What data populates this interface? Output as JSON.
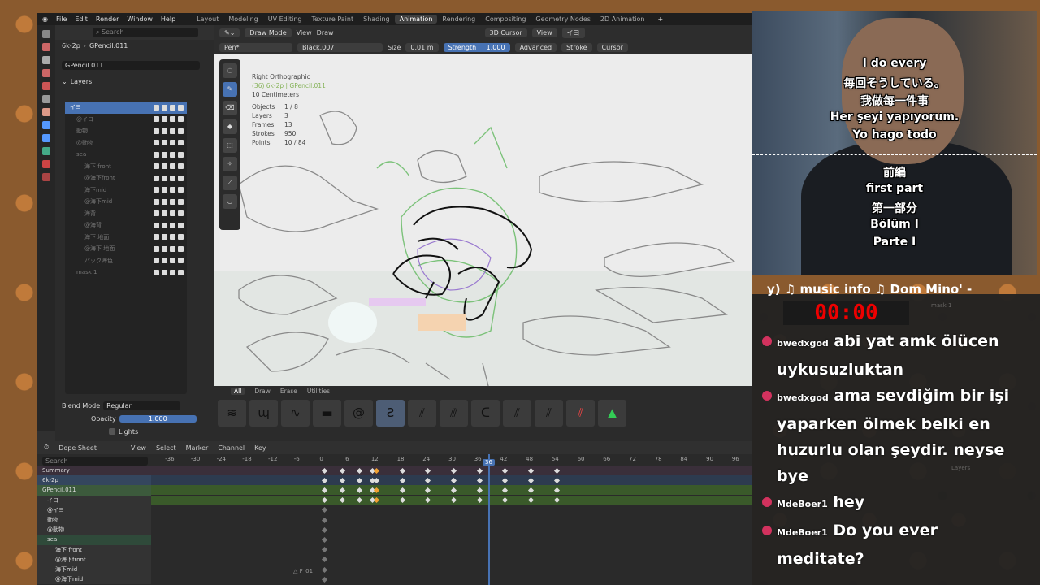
{
  "menus": [
    "File",
    "Edit",
    "Render",
    "Window",
    "Help"
  ],
  "workspaces": [
    {
      "label": "Layout",
      "active": false
    },
    {
      "label": "Modeling",
      "active": false
    },
    {
      "label": "UV Editing",
      "active": false
    },
    {
      "label": "Texture Paint",
      "active": false
    },
    {
      "label": "Shading",
      "active": false
    },
    {
      "label": "Animation",
      "active": true
    },
    {
      "label": "Rendering",
      "active": false
    },
    {
      "label": "Compositing",
      "active": false
    },
    {
      "label": "Geometry Nodes",
      "active": false
    },
    {
      "label": "2D Animation",
      "active": false
    }
  ],
  "props": {
    "object": "6k-2p",
    "data": "GPencil.011",
    "datablock": "GPencil.011",
    "search_placeholder": "Search",
    "layers_title": "Layers",
    "blend_mode_label": "Blend Mode",
    "blend_mode": "Regular",
    "opacity_label": "Opacity",
    "opacity": "1.000",
    "lights_label": "Lights"
  },
  "layers": [
    {
      "name": "イヨ",
      "sel": true
    },
    {
      "name": "@イヨ"
    },
    {
      "name": "動物"
    },
    {
      "name": "@動物"
    },
    {
      "name": "sea"
    },
    {
      "name": "海下 front"
    },
    {
      "name": "@海下front"
    },
    {
      "name": "海下mid"
    },
    {
      "name": "@海下mid"
    },
    {
      "name": "海背"
    },
    {
      "name": "@海背"
    },
    {
      "name": "海下 地面"
    },
    {
      "name": "@海下 地面"
    },
    {
      "name": "バック海色"
    },
    {
      "name": "mask 1"
    }
  ],
  "viewport": {
    "mode": "Draw Mode",
    "view": "View",
    "draw": "Draw",
    "cursor": "3D Cursor",
    "view2": "View",
    "layer": "イヨ",
    "brush": "Pen*",
    "material": "Black.007",
    "size_label": "Size",
    "size": "0.01 m",
    "strength_label": "Strength",
    "strength": "1.000",
    "advanced": "Advanced",
    "stroke": "Stroke",
    "cursor2": "Cursor"
  },
  "overlay": {
    "view_name": "Right Orthographic",
    "object_line": "(36) 6k-2p | GPencil.011",
    "scale": "10 Centimeters",
    "stats": [
      [
        "Objects",
        "1 / 8"
      ],
      [
        "Layers",
        "3"
      ],
      [
        "Frames",
        "13"
      ],
      [
        "Strokes",
        "950"
      ],
      [
        "Points",
        "10 / 84"
      ]
    ]
  },
  "brush_tabs": [
    {
      "label": "All",
      "on": true
    },
    {
      "label": "Draw"
    },
    {
      "label": "Erase"
    },
    {
      "label": "Utilities"
    }
  ],
  "dope": {
    "editor": "Dope Sheet",
    "menus": [
      "View",
      "Select",
      "Marker",
      "Channel",
      "Key"
    ],
    "search_placeholder": "Search",
    "frame": "36",
    "marker": "F_01",
    "ruler": [
      "-36",
      "-30",
      "-24",
      "-18",
      "-12",
      "-6",
      "0",
      "6",
      "12",
      "18",
      "24",
      "30",
      "36",
      "42",
      "48",
      "54",
      "60",
      "66",
      "72",
      "78",
      "84",
      "90",
      "96"
    ],
    "channels": [
      "Summary",
      "6k-2p",
      "GPencil.011",
      "イヨ",
      "@イヨ",
      "動物",
      "@動物",
      "sea",
      "海下 front",
      "@海下front",
      "海下mid",
      "@海下mid"
    ]
  },
  "stream": {
    "sub_top": [
      "I do every",
      "毎回そうしている。",
      "我做每一件事",
      "Her şeyi yapıyorum.",
      "Yo hago todo"
    ],
    "sub_bottom": [
      "前編",
      "first part",
      "第一部分",
      "Bölüm I",
      "Parte I"
    ],
    "music": "y) ♫ music info ♫  Dom Mino' -",
    "timer": "00:00"
  },
  "chat": [
    {
      "user": "bwedxgod",
      "text": "abi yat amk ölücen uykusuzluktan"
    },
    {
      "user": "bwedxgod",
      "text": "ama sevdiğim bir işi yaparken ölmek belki en huzurlu olan şeydir. neyse bye"
    },
    {
      "user": "MdeBoer1",
      "text": "hey"
    },
    {
      "user": "MdeBoer1",
      "text": "Do you ever meditate?"
    }
  ],
  "colors": {
    "accent": "#4772b3",
    "keyframe": "#dddddd",
    "keyframe_active": "#f0a030",
    "timer": "#ee0000",
    "chat_badge": "#d2325e"
  }
}
